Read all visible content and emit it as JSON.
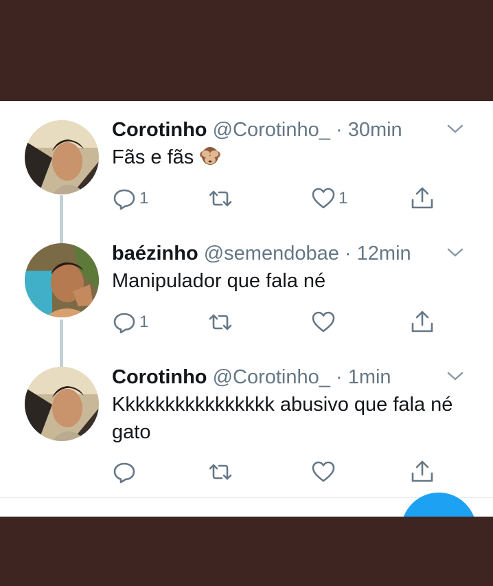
{
  "tweets": [
    {
      "name": "Corotinho",
      "handle": "@Corotinho_",
      "dot": "·",
      "time": "30min",
      "text": "Fãs e fãs",
      "emoji": "see-no-evil-monkey",
      "reply_count": "1",
      "like_count": "1"
    },
    {
      "name": "baézinho",
      "handle": "@semendobae",
      "dot": "·",
      "time": "12min",
      "text": "Manipulador que fala né",
      "reply_count": "1",
      "like_count": ""
    },
    {
      "name": "Corotinho",
      "handle": "@Corotinho_",
      "dot": "·",
      "time": "1min",
      "text": "Kkkkkkkkkkkkkkkk abusivo que fala né gato",
      "reply_count": "",
      "like_count": ""
    }
  ],
  "icons": {
    "reply": "reply-icon",
    "retweet": "retweet-icon",
    "like": "heart-icon",
    "share": "share-icon",
    "menu": "chevron-down-icon"
  },
  "colors": {
    "background": "#3e2522",
    "card": "#ffffff",
    "text": "#14171a",
    "secondary": "#657786",
    "thread_line": "#c4cfd6",
    "fab": "#1da1f2"
  }
}
